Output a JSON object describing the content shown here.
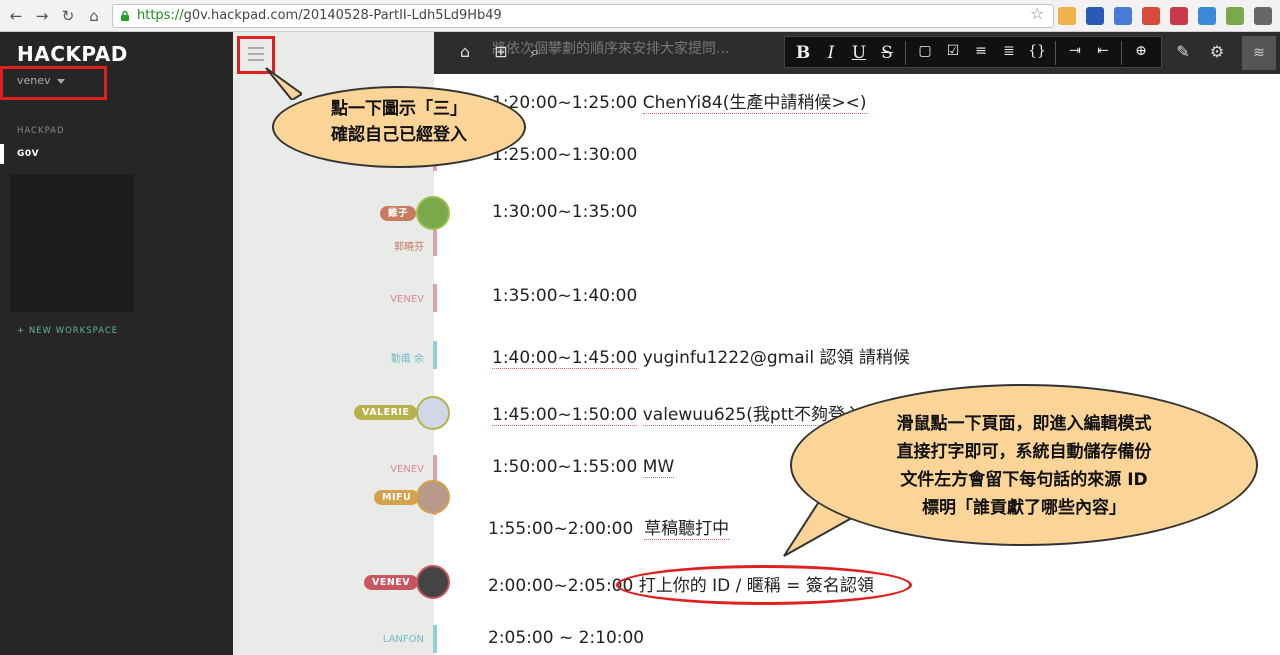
{
  "browser": {
    "url_scheme": "https://",
    "url_rest": "g0v.hackpad.com/20140528-PartII-Ldh5Ld9Hb49",
    "back_label": "←",
    "forward_label": "→",
    "reload_label": "↻",
    "home_label": "⌂"
  },
  "sidebar": {
    "logo": "HACKPAD",
    "username": "venev",
    "section_label": "HACKPAD",
    "active_item": "G0V",
    "new_workspace": "+ NEW WORKSPACE"
  },
  "toolbar": {
    "ghost_text": "將依次個攀劃的順序來安排大家提問...",
    "format_buttons": [
      "B",
      "I",
      "U",
      "S"
    ]
  },
  "rows": [
    {
      "time": "1:20:00~1:25:00",
      "text": "ChenYi84(生產中請稍候><)",
      "author": ""
    },
    {
      "time": "1:25:00~1:30:00",
      "text": "",
      "author": ""
    },
    {
      "time": "1:30:00~1:35:00",
      "text": "",
      "author": "郭曉芬",
      "pill": "錐子"
    },
    {
      "time": "1:35:00~1:40:00",
      "text": "",
      "author": "VENEV"
    },
    {
      "time": "1:40:00~1:45:00",
      "text": "yuginfu1222@gmail 認領 請稍候",
      "author": "勤甫 余"
    },
    {
      "time": "1:45:00~1:50:00",
      "text": "valewuu625(我ptt不夠登入",
      "author": "",
      "pill": "VALERIE"
    },
    {
      "time": "1:50:00~1:55:00",
      "text": "MW",
      "author": "VENEV",
      "pill": "MIFU"
    },
    {
      "time": "1:55:00~2:00:00",
      "text": "草稿聽打中",
      "author": ""
    },
    {
      "time": "2:00:00~2:05:00",
      "text": "打上你的 ID / 暱稱 = 簽名認領",
      "author": "",
      "pill": "VENEV"
    },
    {
      "time": "2:05:00 ~ 2:10:00",
      "text": "",
      "author": "LANFON"
    }
  ],
  "callouts": {
    "menu_hint_line1": "點一下圖示「三」",
    "menu_hint_line2": "確認自己已經登入",
    "edit_hint_line1": "滑鼠點一下頁面，即進入編輯模式",
    "edit_hint_line2": "直接打字即可，系統自動儲存備份",
    "edit_hint_line3": "文件左方會留下每句話的來源 ID",
    "edit_hint_line4": "標明「誰貢獻了哪些內容」"
  },
  "colors": {
    "pink": "#d9a4ab",
    "teal": "#8fd0db",
    "olive": "#b8b04a",
    "salmon": "#c97b5f",
    "mifu": "#d4a24a",
    "venev_pill": "#c9555f"
  }
}
